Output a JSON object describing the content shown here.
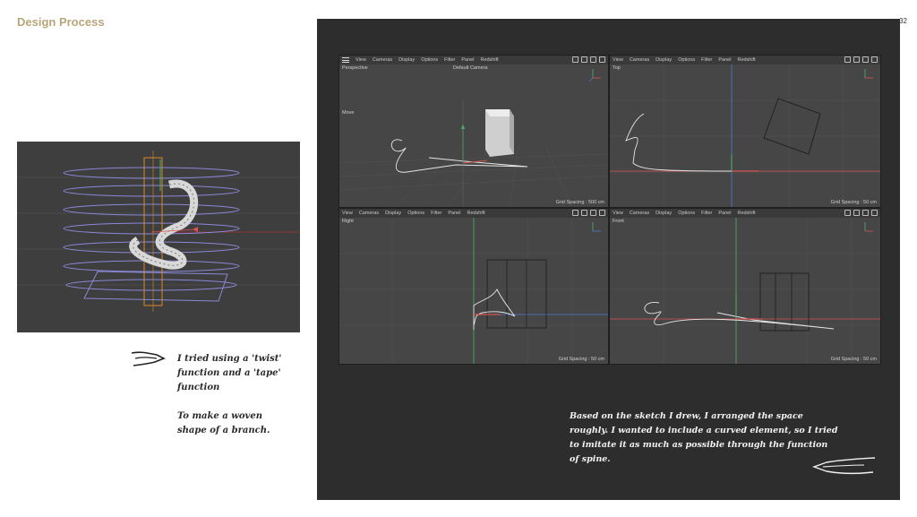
{
  "header": {
    "title": "Design Process",
    "page_number": "32"
  },
  "notes": {
    "left_line1": "I tried using a 'twist' function and a 'tape' function",
    "left_line2": "To make a woven shape of a branch.",
    "right": "Based on the sketch I drew, I arranged the space roughly. I wanted to include a curved element, so I tried to imitate it as much as possible through the function of spine."
  },
  "viewports": [
    {
      "name": "Perspective",
      "camera": "Default Camera",
      "tool": "Move",
      "grid": "Grid Spacing : 500 cm",
      "menu": [
        "View",
        "Cameras",
        "Display",
        "Options",
        "Filter",
        "Panel",
        "Redshift"
      ]
    },
    {
      "name": "Top",
      "grid": "Grid Spacing : 50 cm",
      "menu": [
        "View",
        "Cameras",
        "Display",
        "Options",
        "Filter",
        "Panel",
        "Redshift"
      ]
    },
    {
      "name": "Right",
      "grid": "Grid Spacing : 50 cm",
      "menu": [
        "View",
        "Cameras",
        "Display",
        "Options",
        "Filter",
        "Panel",
        "Redshift"
      ]
    },
    {
      "name": "Front",
      "grid": "Grid Spacing : 50 cm",
      "menu": [
        "View",
        "Cameras",
        "Display",
        "Options",
        "Filter",
        "Panel",
        "Redshift"
      ]
    }
  ],
  "colors": {
    "title": "#b8a57a",
    "panel": "#2d2d2d",
    "viewport": "#464646",
    "axis_x": "#d9534f",
    "axis_y": "#4cb36b",
    "axis_z": "#4a7bd4"
  }
}
